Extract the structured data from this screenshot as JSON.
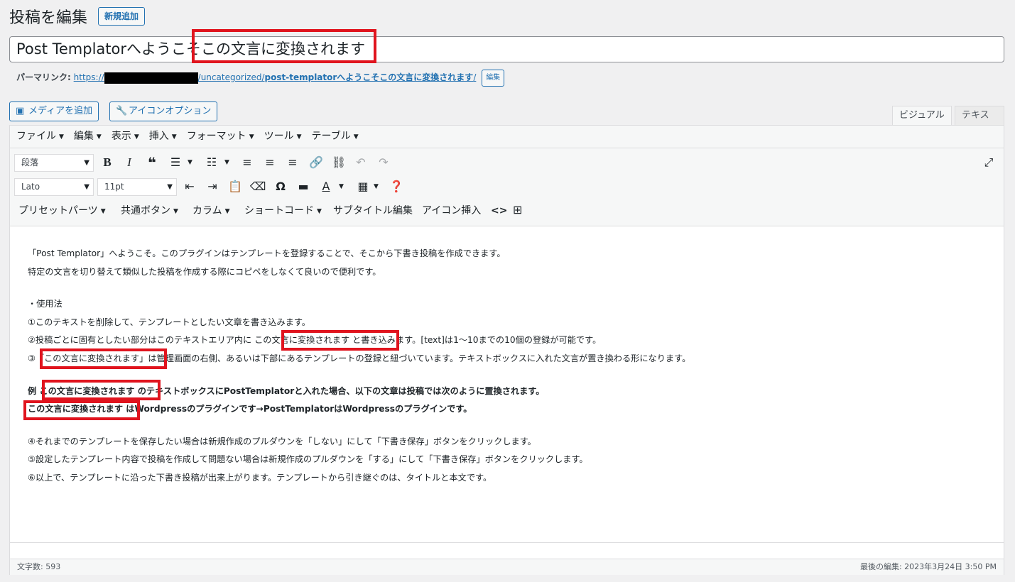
{
  "header": {
    "title": "投稿を編集",
    "new_post_label": "新規追加"
  },
  "post": {
    "title": "Post Templatorへようこそこの文言に変換されます"
  },
  "permalink": {
    "label": "パーマリンク:",
    "url_prefix": "https://",
    "url_path": "/uncategorized/",
    "url_slug": "post-templatorへようこそこの文言に変換されます",
    "url_suffix": "/",
    "edit_label": "編集"
  },
  "media_buttons": {
    "add_media": "メディアを追加",
    "icon_options": "アイコンオプション"
  },
  "tabs": {
    "visual": "ビジュアル",
    "text": "テキスト"
  },
  "menubar": [
    "ファイル",
    "編集",
    "表示",
    "挿入",
    "フォーマット",
    "ツール",
    "テーブル"
  ],
  "toolbar": {
    "format_select": "段落",
    "font_select": "Lato",
    "size_select": "11pt",
    "row3": {
      "preset_parts": "プリセットパーツ",
      "common_buttons": "共通ボタン",
      "columns": "カラム",
      "shortcode": "ショートコード",
      "subtitle_edit": "サブタイトル編集",
      "icon_insert": "アイコン挿入"
    }
  },
  "content": {
    "lines": [
      "「Post Templator」へようこそ。このプラグインはテンプレートを登録することで、そこから下書き投稿を作成できます。",
      "特定の文言を切り替えて類似した投稿を作成する際にコピペをしなくて良いので便利です。",
      "・使用法",
      "①このテキストを削除して、テンプレートとしたい文章を書き込みます。",
      "②投稿ごとに固有としたい部分はこのテキストエリア内に この文言に変換されます と書き込みます。[text]は1～10までの10個の登録が可能です。",
      "③「この文言に変換されます」は管理画面の右側、あるいは下部にあるテンプレートの登録と紐づいています。テキストボックスに入れた文言が置き換わる形になります。",
      "例 この文言に変換されます のテキストボックスにPostTemplatorと入れた場合、以下の文章は投稿では次のように置換されます。",
      "この文言に変換されます はWordpressのプラグインです→PostTemplatorはWordpressのプラグインです。",
      "④それまでのテンプレートを保存したい場合は新規作成のプルダウンを「しない」にして「下書き保存」ボタンをクリックします。",
      "⑤設定したテンプレート内容で投稿を作成して問題ない場合は新規作成のプルダウンを「する」にして「下書き保存」ボタンをクリックします。",
      "⑥以上で、テンプレートに沿った下書き投稿が出来上がります。テンプレートから引き継ぐのは、タイトルと本文です。"
    ]
  },
  "status": {
    "word_count": "文字数: 593",
    "last_edit": "最後の編集: 2023年3月24日 3:50 PM"
  },
  "colors": {
    "accent": "#2271b1",
    "highlight": "#e0141e"
  }
}
